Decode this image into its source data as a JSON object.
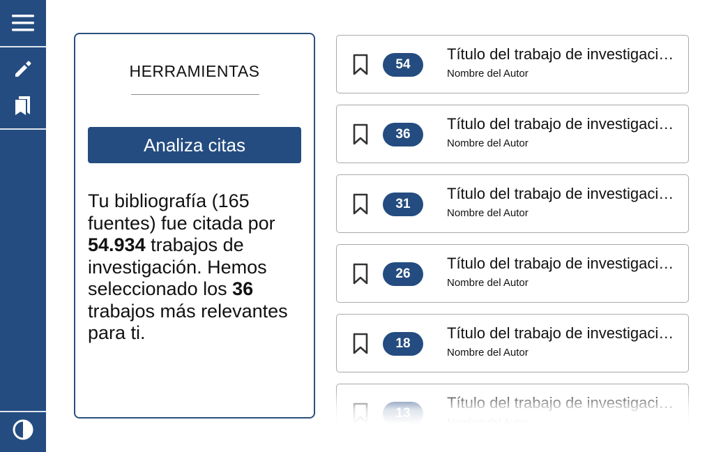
{
  "sidebar": {
    "menu_icon": "hamburger-menu-icon",
    "edit_icon": "pencil-icon",
    "library_icon": "books-icon",
    "theme_icon": "contrast-icon"
  },
  "tools": {
    "title": "HERRAMIENTAS",
    "analyze_label": "Analiza citas",
    "summary": {
      "part1": "Tu bibliografía (165 fuentes) fue citada por ",
      "count_citing": "54.934",
      "part2": " trabajos de investigación. Hemos seleccionado los ",
      "count_selected": "36",
      "part3": " trabajos más relevantes para ti."
    }
  },
  "papers": [
    {
      "citations": "54",
      "title": "Título del trabajo de investigación…",
      "author": "Nombre del Autor"
    },
    {
      "citations": "36",
      "title": "Título del trabajo de investigación…",
      "author": "Nombre del Autor"
    },
    {
      "citations": "31",
      "title": "Título del trabajo de investigación…",
      "author": "Nombre del Autor"
    },
    {
      "citations": "26",
      "title": "Título del trabajo de investigación…",
      "author": "Nombre del Autor"
    },
    {
      "citations": "18",
      "title": "Título del trabajo de investigación…",
      "author": "Nombre del Autor"
    },
    {
      "citations": "13",
      "title": "Título del trabajo de investigación…",
      "author": "Nombre del Autor"
    }
  ],
  "colors": {
    "accent": "#244c80",
    "card_border": "#a9a9a9"
  }
}
